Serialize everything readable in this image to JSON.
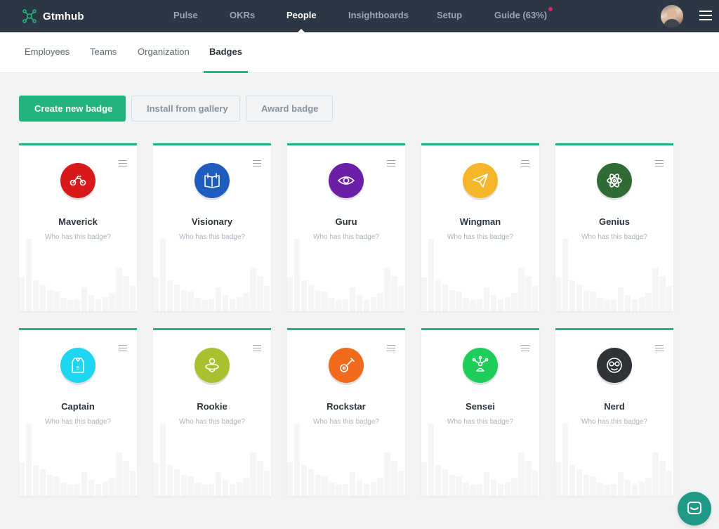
{
  "app": {
    "name": "Gtmhub"
  },
  "topnav": [
    {
      "label": "Pulse",
      "active": false
    },
    {
      "label": "OKRs",
      "active": false
    },
    {
      "label": "People",
      "active": true
    },
    {
      "label": "Insightboards",
      "active": false
    },
    {
      "label": "Setup",
      "active": false
    },
    {
      "label": "Guide (63%)",
      "active": false
    }
  ],
  "subnav": [
    {
      "label": "Employees",
      "active": false
    },
    {
      "label": "Teams",
      "active": false
    },
    {
      "label": "Organization",
      "active": false
    },
    {
      "label": "Badges",
      "active": true
    }
  ],
  "actions": {
    "create": "Create new badge",
    "install": "Install from gallery",
    "award": "Award badge"
  },
  "badge_sub_label": "Who has this badge?",
  "badges": [
    {
      "name": "Maverick",
      "color": "#d7191c",
      "icon": "motorcycle-icon"
    },
    {
      "name": "Visionary",
      "color": "#1e5dbd",
      "icon": "book-icon"
    },
    {
      "name": "Guru",
      "color": "#6b1fa8",
      "icon": "eye-icon"
    },
    {
      "name": "Wingman",
      "color": "#f5b62a",
      "icon": "paper-plane-icon"
    },
    {
      "name": "Genius",
      "color": "#2e6b35",
      "icon": "atom-icon"
    },
    {
      "name": "Captain",
      "color": "#1ed6f0",
      "icon": "captain-shirt-icon"
    },
    {
      "name": "Rookie",
      "color": "#a8c12e",
      "icon": "pacifier-icon"
    },
    {
      "name": "Rockstar",
      "color": "#f26b1d",
      "icon": "guitar-icon"
    },
    {
      "name": "Sensei",
      "color": "#1fce5a",
      "icon": "network-person-icon"
    },
    {
      "name": "Nerd",
      "color": "#2f3338",
      "icon": "nerd-face-icon"
    }
  ],
  "colors": {
    "accent": "#23b47e",
    "topbar": "#2c3744",
    "chat": "#1f9a86"
  }
}
